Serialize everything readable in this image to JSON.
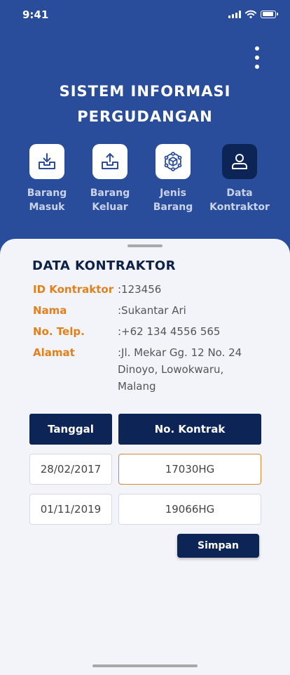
{
  "status_bar": {
    "time": "9:41"
  },
  "app": {
    "title_line1": "SISTEM INFORMASI",
    "title_line2": "PERGUDANGAN"
  },
  "menu": [
    {
      "line1": "Barang",
      "line2": "Masuk",
      "icon": "inbox-down-icon"
    },
    {
      "line1": "Barang",
      "line2": "Keluar",
      "icon": "inbox-up-icon"
    },
    {
      "line1": "Jenis",
      "line2": "Barang",
      "icon": "cube-network-icon"
    },
    {
      "line1": "Data",
      "line2": "Kontraktor",
      "icon": "user-icon",
      "active": true
    }
  ],
  "section": {
    "title": "DATA KONTRAKTOR"
  },
  "fields": [
    {
      "label": "ID Kontraktor",
      "value": ":123456"
    },
    {
      "label": "Nama",
      "value": ":Sukantar Ari"
    },
    {
      "label": "No. Telp.",
      "value": ":+62 134 4556 565"
    },
    {
      "label": "Alamat",
      "value": ":Jl. Mekar Gg. 12 No. 24 Dinoyo, Lowokwaru, Malang"
    }
  ],
  "table": {
    "headers": [
      "Tanggal",
      "No. Kontrak"
    ],
    "rows": [
      [
        "28/02/2017",
        "17030HG"
      ],
      [
        "01/11/2019",
        "19066HG"
      ]
    ]
  },
  "actions": {
    "save_label": "Simpan"
  },
  "colors": {
    "header_bg": "#2a4d9b",
    "navy": "#0c2456",
    "label_orange": "#e2811c",
    "focus_border": "#d9892c"
  }
}
